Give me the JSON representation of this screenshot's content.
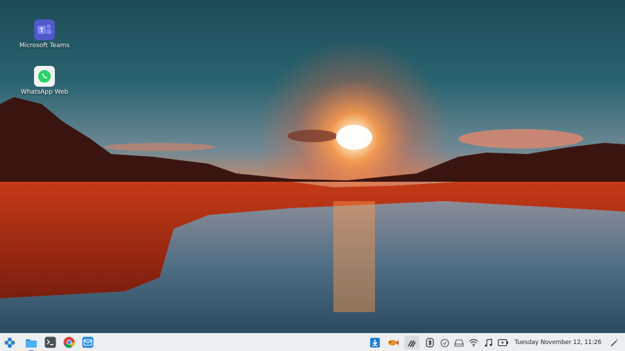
{
  "desktop": {
    "icons": [
      {
        "label": "Microsoft Teams"
      },
      {
        "label": "WhatsApp Web"
      }
    ]
  },
  "taskbar": {
    "launcher_icon": "app-launcher-icon",
    "apps": [
      "files-icon",
      "terminal-icon",
      "chrome-icon",
      "mail-icon"
    ],
    "tray_icons": [
      "download-icon",
      "fish-icon",
      "tools-icon",
      "bluetooth-icon",
      "check-icon",
      "drive-icon",
      "wifi-icon",
      "music-icon",
      "battery-icon"
    ],
    "clock": "Tuesday November 12, 11:26",
    "pen_icon": "pen-icon"
  },
  "colors": {
    "taskbar_bg": "#eceff2",
    "accent": "#3b82f6",
    "sky_top": "#1f4f5e",
    "sunset": "#ff5a1f"
  }
}
